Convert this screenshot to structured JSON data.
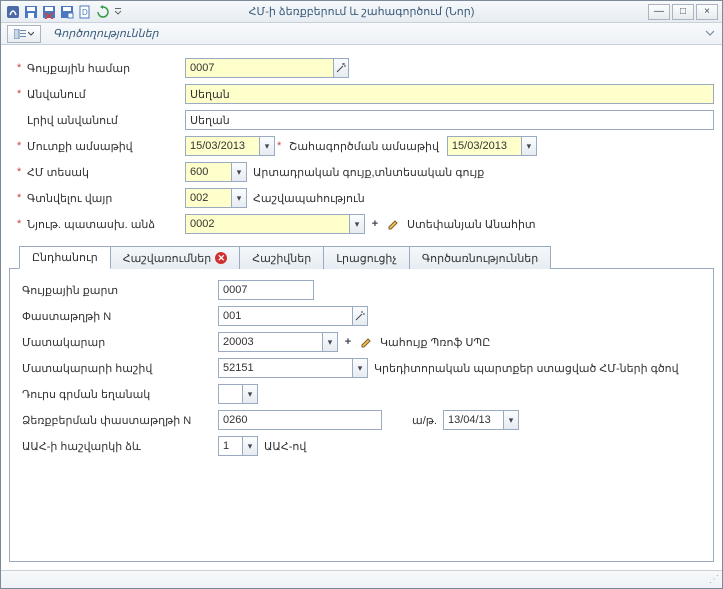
{
  "window": {
    "title": "ՀՄ-ի ձեռքբերում և շահագործում (Նոր)"
  },
  "menubar": {
    "actions": "Գործողություններ"
  },
  "form": {
    "inventory_number_label": "Գույքային համար",
    "inventory_number": "0007",
    "name_label": "Անվանում",
    "name": "Սեղան",
    "full_name_label": "Լրիվ անվանում",
    "full_name": "Սեղան",
    "entry_date_label": "Մուտքի ամսաթիվ",
    "entry_date": "15/03/2013",
    "oper_date_label": "Շահագործման ամսաթիվ",
    "oper_date": "15/03/2013",
    "fa_type_label": "ՀՄ տեսակ",
    "fa_type": "600",
    "fa_type_desc": "Արտադրական գույք,տնտեսական գույք",
    "location_label": "Գտնվելու վայր",
    "location": "002",
    "location_desc": "Հաշվապահություն",
    "responsible_label": "Նյութ. պատասխ. անձ",
    "responsible": "0002",
    "responsible_desc": "Ստեփանյան Անահիտ"
  },
  "tabs": {
    "general": "Ընդհանուր",
    "calculations": "Հաշվառումներ",
    "accounts": "Հաշիվներ",
    "additional": "Լրացուցիչ",
    "functions": "Գործառնություններ"
  },
  "general_panel": {
    "card_label": "Գույքային քարտ",
    "card": "0007",
    "doc_n_label": "Փաստաթղթի N",
    "doc_n": "001",
    "supplier_label": "Մատակարար",
    "supplier": "20003",
    "supplier_desc": "Կահույք Պռոֆ ՍՊԸ",
    "supplier_account_label": "Մատակարարի հաշիվ",
    "supplier_account": "52151",
    "supplier_account_desc": "Կրեդիտորական պարտքեր ստացված ՀՄ-ների գծով",
    "export_mode_label": "Դուրս գրման եղանակ",
    "export_mode": "",
    "acq_doc_label": "Ձեռքբերման փաստաթղթի N",
    "acq_doc": "0260",
    "acq_date_label": "ա/թ.",
    "acq_date": "13/04/13",
    "vat_mode_label": "ԱԱՀ-ի հաշվարկի ձև",
    "vat_mode": "1",
    "vat_mode_desc": "ԱԱՀ-ով"
  }
}
